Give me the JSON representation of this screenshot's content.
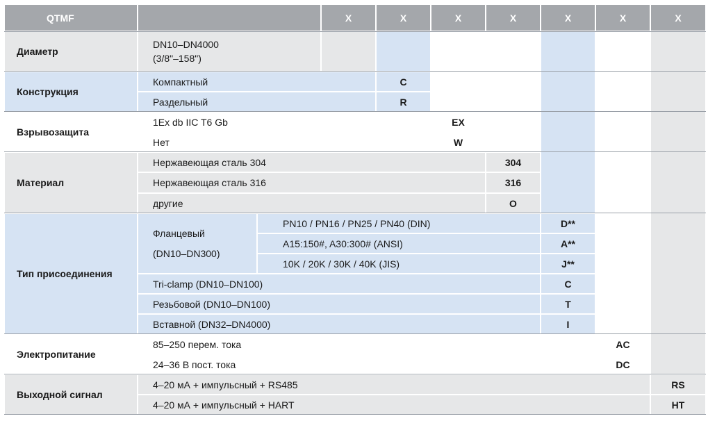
{
  "header": {
    "model": "QTMF",
    "columns": [
      "X",
      "X",
      "X",
      "X",
      "X",
      "X",
      "X"
    ]
  },
  "diameter": {
    "label": "Диаметр",
    "value_line1": "DN10–DN4000",
    "value_line2": "(3/8\"–158\")"
  },
  "construction": {
    "label": "Конструкция",
    "options": [
      {
        "text": "Компактный",
        "code": "C"
      },
      {
        "text": "Раздельный",
        "code": "R"
      }
    ]
  },
  "explosion": {
    "label": "Взрывозащита",
    "options": [
      {
        "text": "1Ex db IIC T6 Gb",
        "code": "EX"
      },
      {
        "text": "Нет",
        "code": "W"
      }
    ]
  },
  "material": {
    "label": "Материал",
    "options": [
      {
        "text": "Нержавеющая сталь 304",
        "code": "304"
      },
      {
        "text": "Нержавеющая сталь 316",
        "code": "316"
      },
      {
        "text": "другие",
        "code": "O"
      }
    ]
  },
  "connection": {
    "label": "Тип присоединения",
    "flange_label_line1": "Фланцевый",
    "flange_label_line2": "(DN10–DN300)",
    "flange_options": [
      {
        "text": "PN10 / PN16 / PN25 / PN40 (DIN)",
        "code": "D**"
      },
      {
        "text": "A15:150#, A30:300# (ANSI)",
        "code": "A**"
      },
      {
        "text": "10K / 20K / 30K / 40K (JIS)",
        "code": "J**"
      }
    ],
    "options": [
      {
        "text": "Tri-clamp (DN10–DN100)",
        "code": "C"
      },
      {
        "text": "Резьбовой (DN10–DN100)",
        "code": "T"
      },
      {
        "text": "Вставной (DN32–DN4000)",
        "code": "I"
      }
    ]
  },
  "power": {
    "label": "Электропитание",
    "options": [
      {
        "text": "85–250 перем. тока",
        "code": "AC"
      },
      {
        "text": "24–36 В пост. тока",
        "code": "DC"
      }
    ]
  },
  "output": {
    "label": "Выходной сигнал",
    "options": [
      {
        "text": "4–20 мА + импульсный + RS485",
        "code": "RS"
      },
      {
        "text": "4–20 мА + импульсный + HART",
        "code": "HT"
      }
    ]
  }
}
